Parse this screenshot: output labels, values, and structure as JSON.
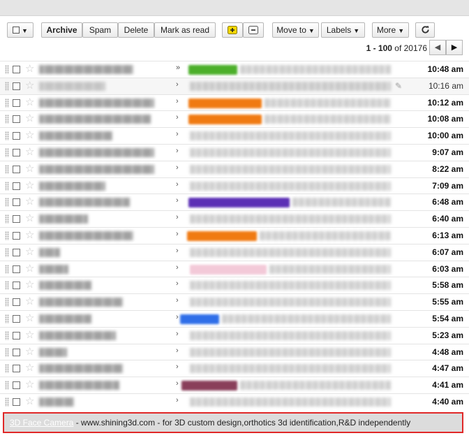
{
  "toolbar": {
    "archive": "Archive",
    "spam": "Spam",
    "delete": "Delete",
    "mark_read": "Mark as read",
    "move_to": "Move to",
    "labels": "Labels",
    "more": "More",
    "refresh_icon": "refresh-icon",
    "add_icon": "add-icon",
    "remove_icon": "remove-icon"
  },
  "pager": {
    "range": "1 - 100",
    "of": "of",
    "total": "20176"
  },
  "rows": [
    {
      "time": "10:48 am",
      "unread": true
    },
    {
      "time": "10:16 am",
      "unread": false
    },
    {
      "time": "10:12 am",
      "unread": true
    },
    {
      "time": "10:08 am",
      "unread": true
    },
    {
      "time": "10:00 am",
      "unread": true
    },
    {
      "time": "9:07 am",
      "unread": true
    },
    {
      "time": "8:22 am",
      "unread": true
    },
    {
      "time": "7:09 am",
      "unread": true
    },
    {
      "time": "6:48 am",
      "unread": true
    },
    {
      "time": "6:40 am",
      "unread": true
    },
    {
      "time": "6:13 am",
      "unread": true
    },
    {
      "time": "6:07 am",
      "unread": true
    },
    {
      "time": "6:03 am",
      "unread": true
    },
    {
      "time": "5:58 am",
      "unread": true
    },
    {
      "time": "5:55 am",
      "unread": true
    },
    {
      "time": "5:54 am",
      "unread": true
    },
    {
      "time": "5:23 am",
      "unread": true
    },
    {
      "time": "4:48 am",
      "unread": true
    },
    {
      "time": "4:47 am",
      "unread": true
    },
    {
      "time": "4:41 am",
      "unread": true
    },
    {
      "time": "4:40 am",
      "unread": true
    }
  ],
  "ad": {
    "link": "3D Face Camera",
    "text": " - www.shining3d.com - for 3D custom design,orthotics 3d identification,R&D independently"
  },
  "colors": {
    "label_green": "#4caf2a",
    "label_orange": "#f07a12",
    "label_purple": "#5b2fb5",
    "label_blue": "#2f6ee8",
    "label_pink": "#f3c9d8",
    "label_mauve": "#8a3f5a",
    "highlight_border": "#e02828"
  }
}
